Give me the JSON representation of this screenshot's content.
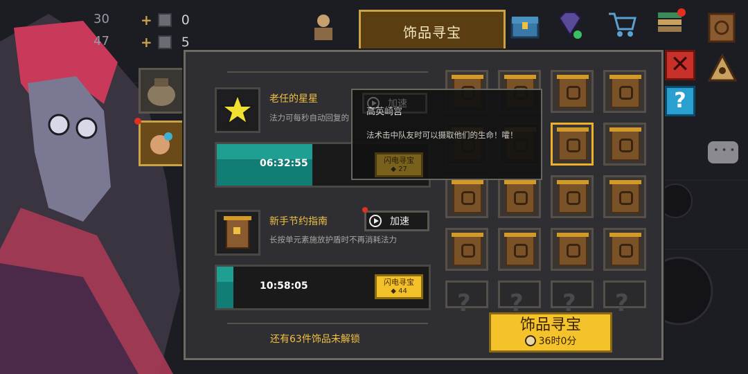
{
  "resources": [
    {
      "label_left": "30",
      "count": "0"
    },
    {
      "label_left": "47",
      "count": "5"
    }
  ],
  "title_tab": "饰品寻宝",
  "items": [
    {
      "name": "老任的星星",
      "desc": "法力可每秒自动回复的",
      "timer": "06:32:55",
      "progress": 0.45,
      "speed_label": "加速"
    },
    {
      "name": "新手节约指南",
      "desc": "长按单元素施放护盾时不再消耗法力",
      "timer": "10:58:05",
      "progress": 0.08,
      "speed_label": "加速",
      "lightning_label": "闪电寻宝",
      "lightning_cost": "44"
    }
  ],
  "tooltip": {
    "title": "高英崎宫",
    "desc": "法术击中队友时可以摄取他们的生命！嚯！",
    "lightning_label": "闪电寻宝",
    "lightning_cost": "27"
  },
  "footer_text": "还有63件饰品未解锁",
  "main_button": {
    "label": "饰品寻宝",
    "time": "36时0分"
  },
  "colors": {
    "accent_gold": "#f4c22a",
    "progress_teal": "#127d74",
    "panel": "#2f2f33"
  },
  "icons": [
    "star-icon",
    "scroll-icon",
    "chest-icon",
    "gem-icon",
    "cart-icon",
    "coins-icon",
    "book-icon",
    "close-icon",
    "help-icon",
    "chat-icon",
    "camp-icon"
  ]
}
